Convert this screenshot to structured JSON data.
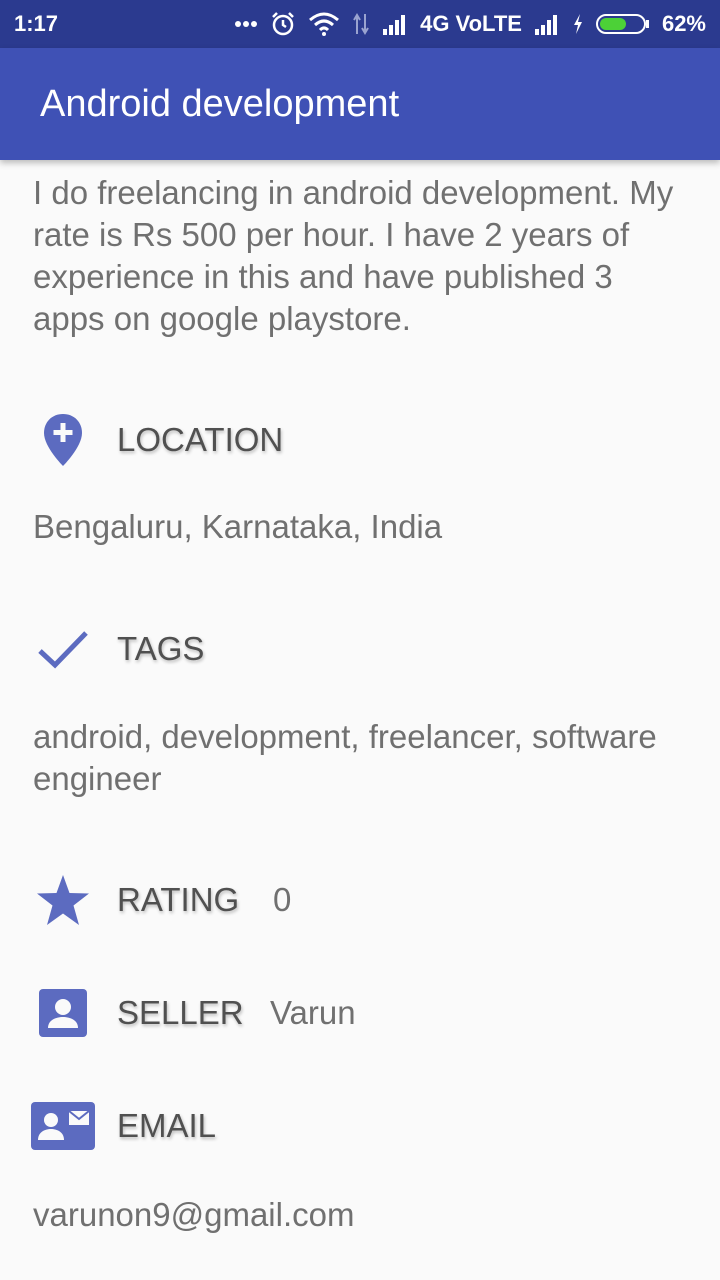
{
  "status_bar": {
    "time": "1:17",
    "network": "4G VoLTE",
    "battery": "62%",
    "battery_fraction": 0.62,
    "icons": [
      "more-dots-icon",
      "alarm-icon",
      "wifi-icon",
      "data-arrows-icon",
      "signal-icon",
      "signal-icon",
      "charging-icon",
      "battery-icon"
    ]
  },
  "app_bar": {
    "title": "Android development"
  },
  "colors": {
    "primary": "#3f51b5",
    "primary_dark": "#2b3a8f",
    "icon": "#5c6bc0",
    "text": "#707070"
  },
  "description": "I do freelancing in android development. My rate is Rs 500 per hour. I have 2 years of experience in this and have published 3 apps on google playstore.",
  "location": {
    "label": "LOCATION",
    "value": "Bengaluru, Karnataka, India",
    "icon": "add-location-icon"
  },
  "tags": {
    "label": "TAGS",
    "value": "android, development, freelancer, software engineer",
    "icon": "check-icon"
  },
  "rating": {
    "label": "RATING",
    "value": "0",
    "icon": "star-icon"
  },
  "seller": {
    "label": "SELLER",
    "value": "Varun",
    "icon": "account-box-icon"
  },
  "email": {
    "label": "EMAIL",
    "value": "varunon9@gmail.com",
    "icon": "contact-mail-icon"
  }
}
